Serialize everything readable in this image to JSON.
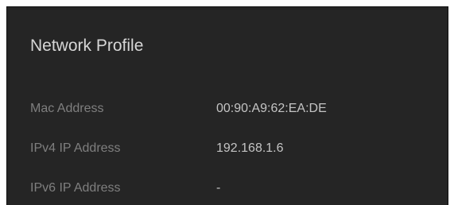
{
  "panel": {
    "title": "Network Profile",
    "rows": [
      {
        "label": "Mac Address",
        "value": "00:90:A9:62:EA:DE"
      },
      {
        "label": "IPv4 IP Address",
        "value": "192.168.1.6"
      },
      {
        "label": "IPv6 IP Address",
        "value": "-"
      }
    ]
  },
  "colors": {
    "panel_background": "#252525",
    "title_text": "#d6d6d6",
    "label_text": "#7f7f7f",
    "value_text": "#c4c4c4"
  }
}
